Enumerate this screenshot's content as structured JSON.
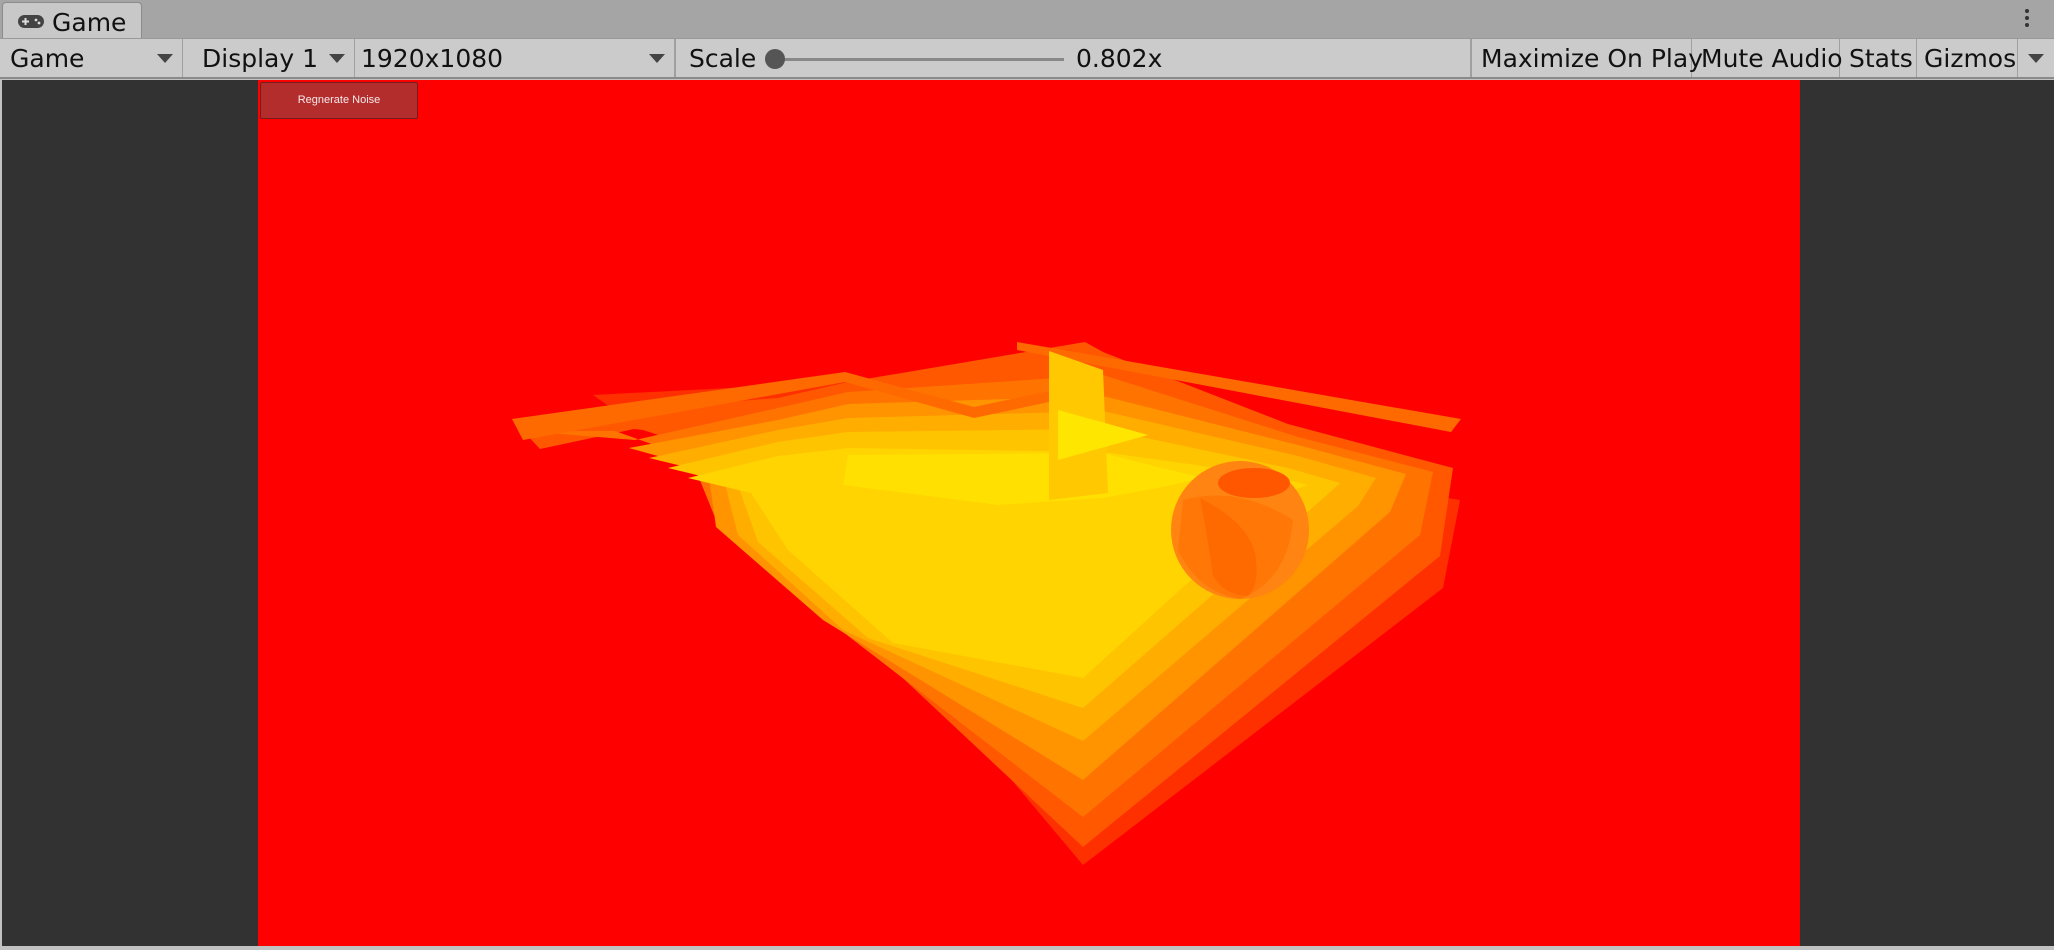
{
  "tab": {
    "title": "Game",
    "icon": "gamepad-icon"
  },
  "toolbar": {
    "view_mode": "Game",
    "display": "Display 1",
    "resolution": "1920x1080",
    "scale_label": "Scale",
    "scale_value": "0.802x",
    "maximize_on_play": "Maximize On Play",
    "mute_audio": "Mute Audio",
    "stats": "Stats",
    "gizmos": "Gizmos"
  },
  "game": {
    "button_label": "Regnerate Noise",
    "background_color": "#ff0000",
    "terrain_colors": [
      "#ff2d00",
      "#ff5a00",
      "#ff7800",
      "#ff9500",
      "#ffb000",
      "#ffc800",
      "#ffe000"
    ],
    "sphere_color": "#ff7a10"
  }
}
